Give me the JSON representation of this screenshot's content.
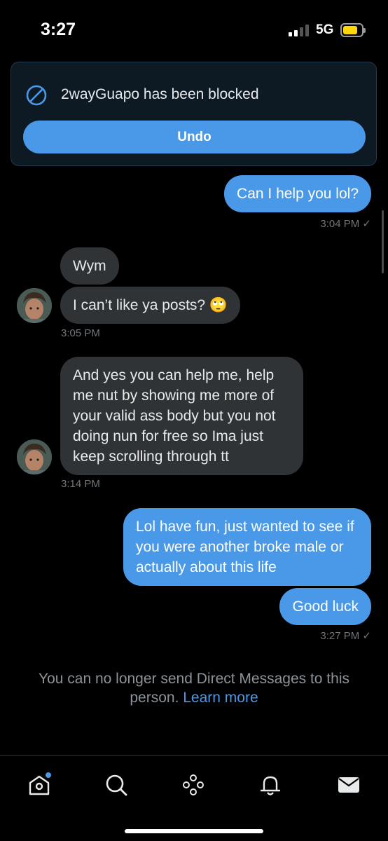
{
  "status_bar": {
    "time": "3:27",
    "network": "5G"
  },
  "toast": {
    "message": "2wayGuapo has been blocked",
    "undo_label": "Undo"
  },
  "messages": [
    {
      "text": "Can I help you lol?",
      "direction": "out"
    },
    {
      "text": "3:04 PM ✓"
    },
    {
      "text": "Wym",
      "direction": "in"
    },
    {
      "text": "I can’t like ya posts? 🙄",
      "direction": "in"
    },
    {
      "text": "3:05 PM"
    },
    {
      "text": "And yes you can help me, help me nut by showing me more of your valid ass body but you not doing nun for free so Ima just keep scrolling through tt",
      "direction": "in"
    },
    {
      "text": "3:14 PM"
    },
    {
      "text": "Lol have fun, just wanted to see if you were another broke male or actually about this life",
      "direction": "out"
    },
    {
      "text": "Good luck",
      "direction": "out"
    },
    {
      "text": "3:27 PM ✓"
    }
  ],
  "footer_note": {
    "text": "You can no longer send Direct Messages to this person.",
    "link": "Learn more"
  },
  "tab_bar": {
    "tabs": [
      {
        "icon": "home-icon",
        "has_notification_dot": true
      },
      {
        "icon": "search-icon"
      },
      {
        "icon": "spaces-icon"
      },
      {
        "icon": "bell-icon"
      },
      {
        "icon": "mail-icon"
      }
    ]
  },
  "colors": {
    "accent": "#4a99e9",
    "incoming_bubble": "#2f3336",
    "background": "#000000",
    "muted_text": "#71767b"
  }
}
